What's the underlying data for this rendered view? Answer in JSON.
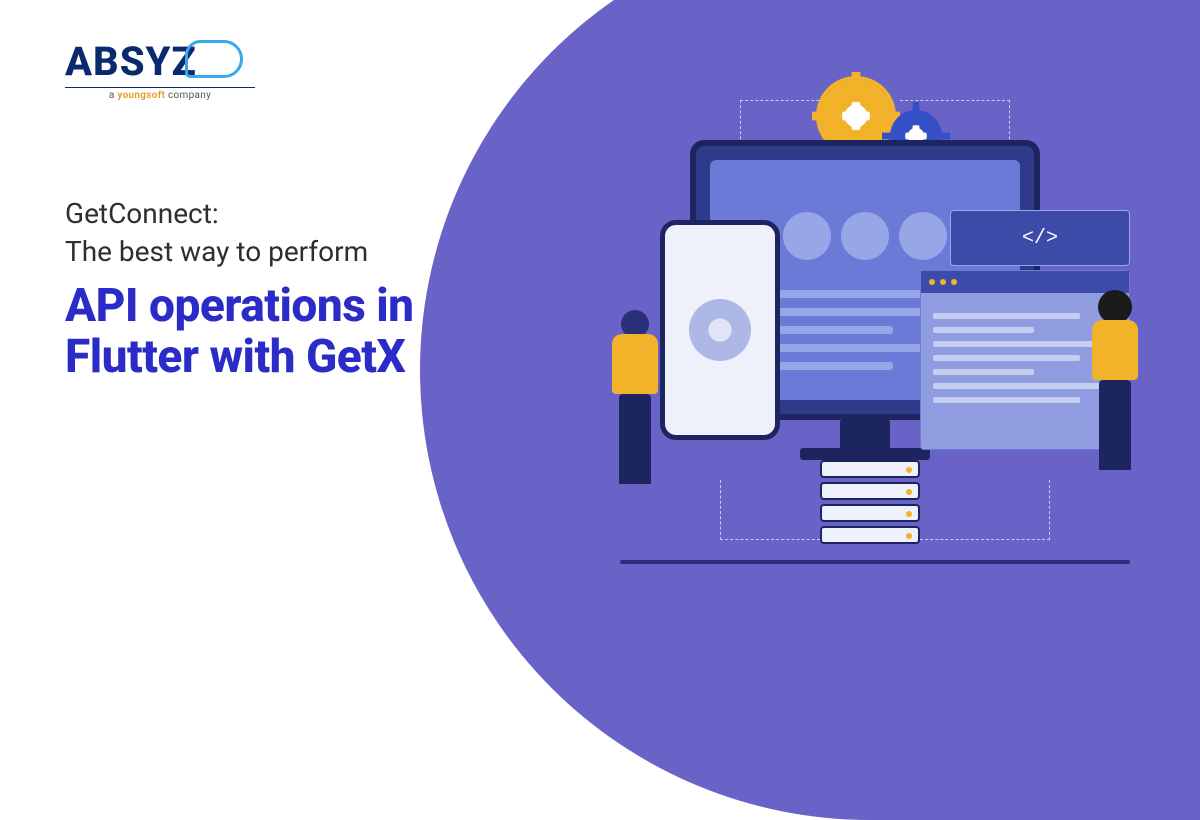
{
  "logo": {
    "text": "ABSYZ",
    "tagline_prefix": "a ",
    "tagline_accent": "youngsoft",
    "tagline_suffix": " company"
  },
  "headline": {
    "kicker_line1": "GetConnect:",
    "kicker_line2": "The best way to perform",
    "title_line1": "API operations in",
    "title_line2": "Flutter with GetX"
  },
  "illustration": {
    "code_glyph": "</>"
  },
  "colors": {
    "brand_blue": "#2b2bc7",
    "swoosh": "#6a63c7",
    "accent_yellow": "#f2b22a",
    "dark_navy": "#1d2560"
  }
}
